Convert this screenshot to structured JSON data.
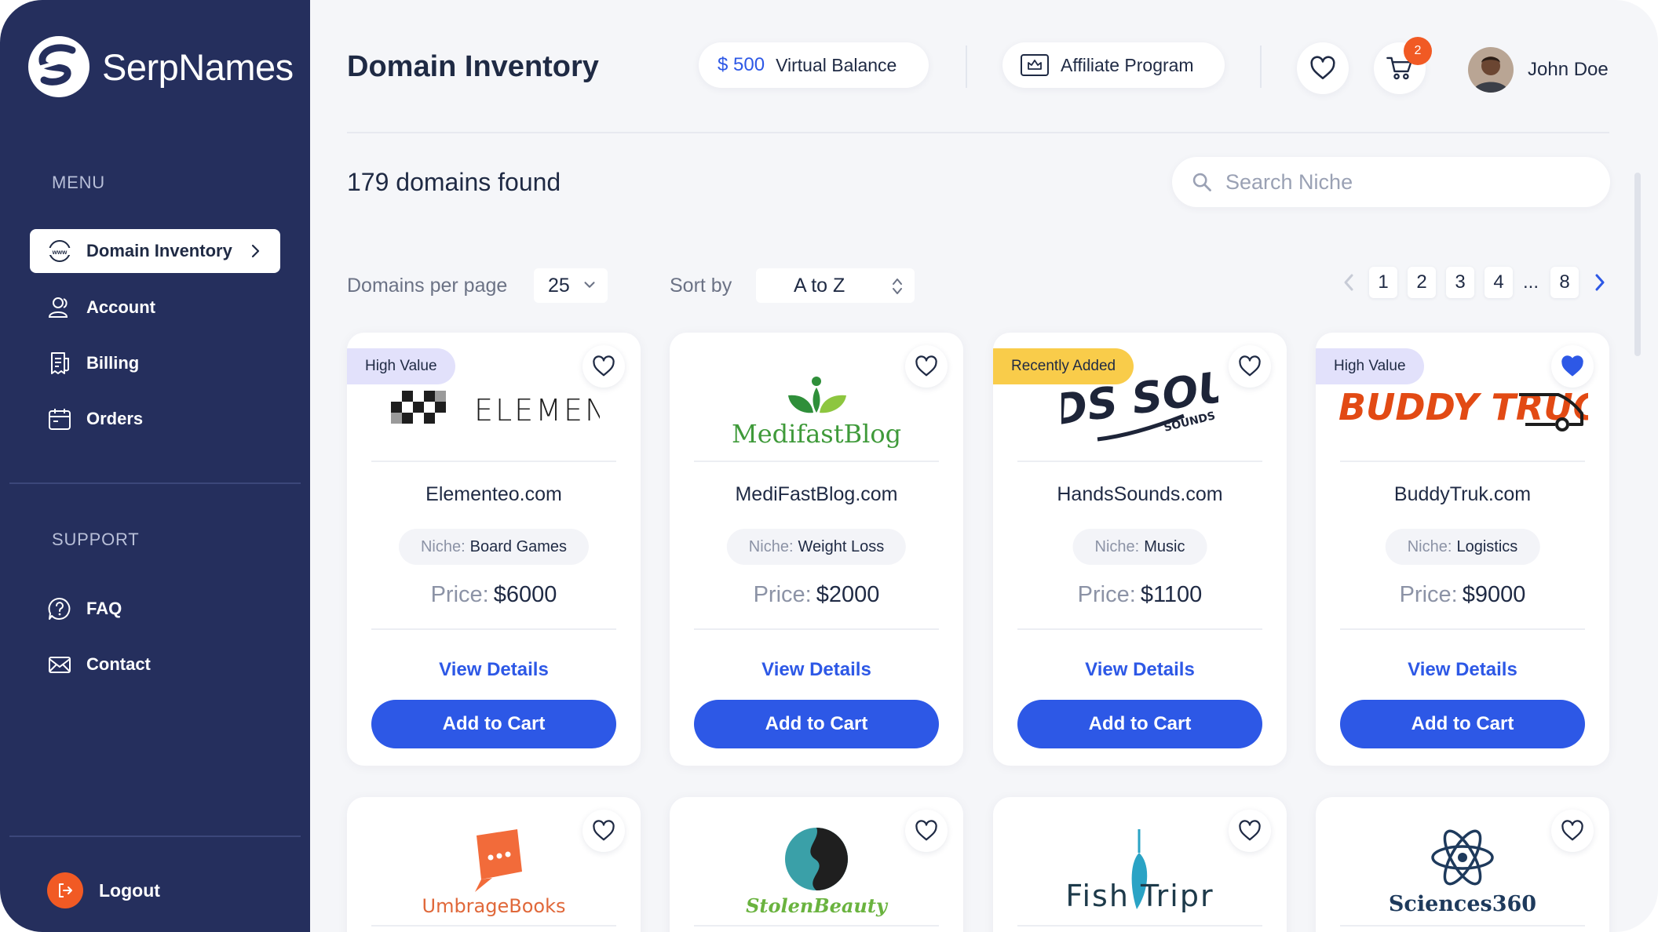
{
  "brand": {
    "name": "SerpNames"
  },
  "sidebar": {
    "menu_heading": "MENU",
    "support_heading": "SUPPORT",
    "menu_items": [
      {
        "label": "Domain Inventory",
        "icon": "www-icon",
        "active": true
      },
      {
        "label": "Account",
        "icon": "users-icon"
      },
      {
        "label": "Billing",
        "icon": "receipt-icon"
      },
      {
        "label": "Orders",
        "icon": "calendar-icon"
      }
    ],
    "support_items": [
      {
        "label": "FAQ",
        "icon": "question-icon"
      },
      {
        "label": "Contact",
        "icon": "envelope-icon"
      }
    ],
    "logout": "Logout"
  },
  "header": {
    "title": "Domain Inventory",
    "balance_amount": "$ 500",
    "balance_label": "Virtual Balance",
    "affiliate_label": "Affiliate Program",
    "cart_count": "2",
    "user_name": "John Doe"
  },
  "toolbar": {
    "found_text": "179 domains found",
    "search_placeholder": "Search Niche",
    "per_page_label": "Domains per page",
    "per_page_value": "25",
    "sort_label": "Sort by",
    "sort_value": "A to Z"
  },
  "pagination": {
    "pages": [
      "1",
      "2",
      "3",
      "4",
      "...",
      "8"
    ],
    "current": "1"
  },
  "card_labels": {
    "niche_prefix": "Niche:",
    "price_prefix": "Price:",
    "view_details": "View Details",
    "add_to_cart": "Add to Cart"
  },
  "domains": [
    {
      "tag": "High Value",
      "tag_color": "#e2e1fb",
      "logo_text": "ELEMENTEO",
      "name": "Elementeo.com",
      "niche": "Board Games",
      "price": "$6000",
      "favorited": false
    },
    {
      "tag": "",
      "logo_text": "MedifastBlog",
      "name": "MediFastBlog.com",
      "niche": "Weight Loss",
      "price": "$2000",
      "favorited": false
    },
    {
      "tag": "Recently Added",
      "tag_color": "#f9cc4a",
      "logo_text": "HANDS SOUNDS",
      "name": "HandsSounds.com",
      "niche": "Music",
      "price": "$1100",
      "favorited": false
    },
    {
      "tag": "High Value",
      "tag_color": "#e2e1fb",
      "logo_text": "BUDDY TRUCK",
      "name": "BuddyTruk.com",
      "niche": "Logistics",
      "price": "$9000",
      "favorited": true
    },
    {
      "tag": "",
      "logo_text": "UmbrageBooks",
      "favorited": false
    },
    {
      "tag": "",
      "logo_text": "StolenBeauty",
      "favorited": false
    },
    {
      "tag": "",
      "logo_text": "Fish Tripr",
      "favorited": false
    },
    {
      "tag": "",
      "logo_text": "Sciences360",
      "favorited": false
    }
  ],
  "colors": {
    "sidebar": "#252f5d",
    "accent": "#2d58e6",
    "badge": "#f15a24"
  }
}
